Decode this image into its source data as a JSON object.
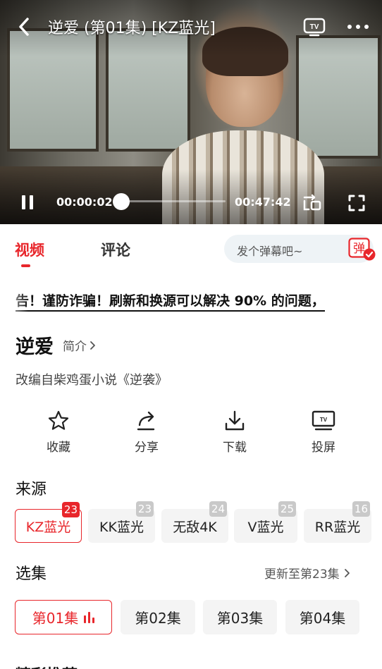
{
  "player": {
    "title": "逆爱 (第01集) [KZ蓝光]",
    "current_time": "00:00:02",
    "duration": "00:47:42",
    "progress": 0.0007
  },
  "tabs": [
    {
      "label": "视频",
      "active": true
    },
    {
      "label": "评论",
      "active": false
    }
  ],
  "danmu": {
    "placeholder": "发个弹幕吧~",
    "button_text": "弹"
  },
  "notice": "告！谨防诈骗！刷新和换源可以解决 90% 的问题，",
  "show": {
    "title": "逆爱",
    "intro_link": "简介",
    "description": "改编自柴鸡蛋小说《逆袭》"
  },
  "actions": [
    {
      "label": "收藏",
      "icon": "star-icon"
    },
    {
      "label": "分享",
      "icon": "share-icon"
    },
    {
      "label": "下载",
      "icon": "download-icon"
    },
    {
      "label": "投屏",
      "icon": "tv-icon"
    }
  ],
  "sources": {
    "title": "来源",
    "items": [
      {
        "label": "KZ蓝光",
        "count": "23",
        "active": true
      },
      {
        "label": "KK蓝光",
        "count": "23",
        "active": false
      },
      {
        "label": "无敌4K",
        "count": "24",
        "active": false
      },
      {
        "label": "V蓝光",
        "count": "25",
        "active": false
      },
      {
        "label": "RR蓝光",
        "count": "16",
        "active": false
      }
    ]
  },
  "episodes": {
    "title": "选集",
    "update_text": "更新至第23集",
    "items": [
      {
        "label": "第01集",
        "active": true
      },
      {
        "label": "第02集",
        "active": false
      },
      {
        "label": "第03集",
        "active": false
      },
      {
        "label": "第04集",
        "active": false
      }
    ]
  },
  "next_section": "精彩推荐",
  "colors": {
    "accent": "#e8262b",
    "chip_bg": "#f4f4f4",
    "badge_gray": "#c9c9c9"
  }
}
